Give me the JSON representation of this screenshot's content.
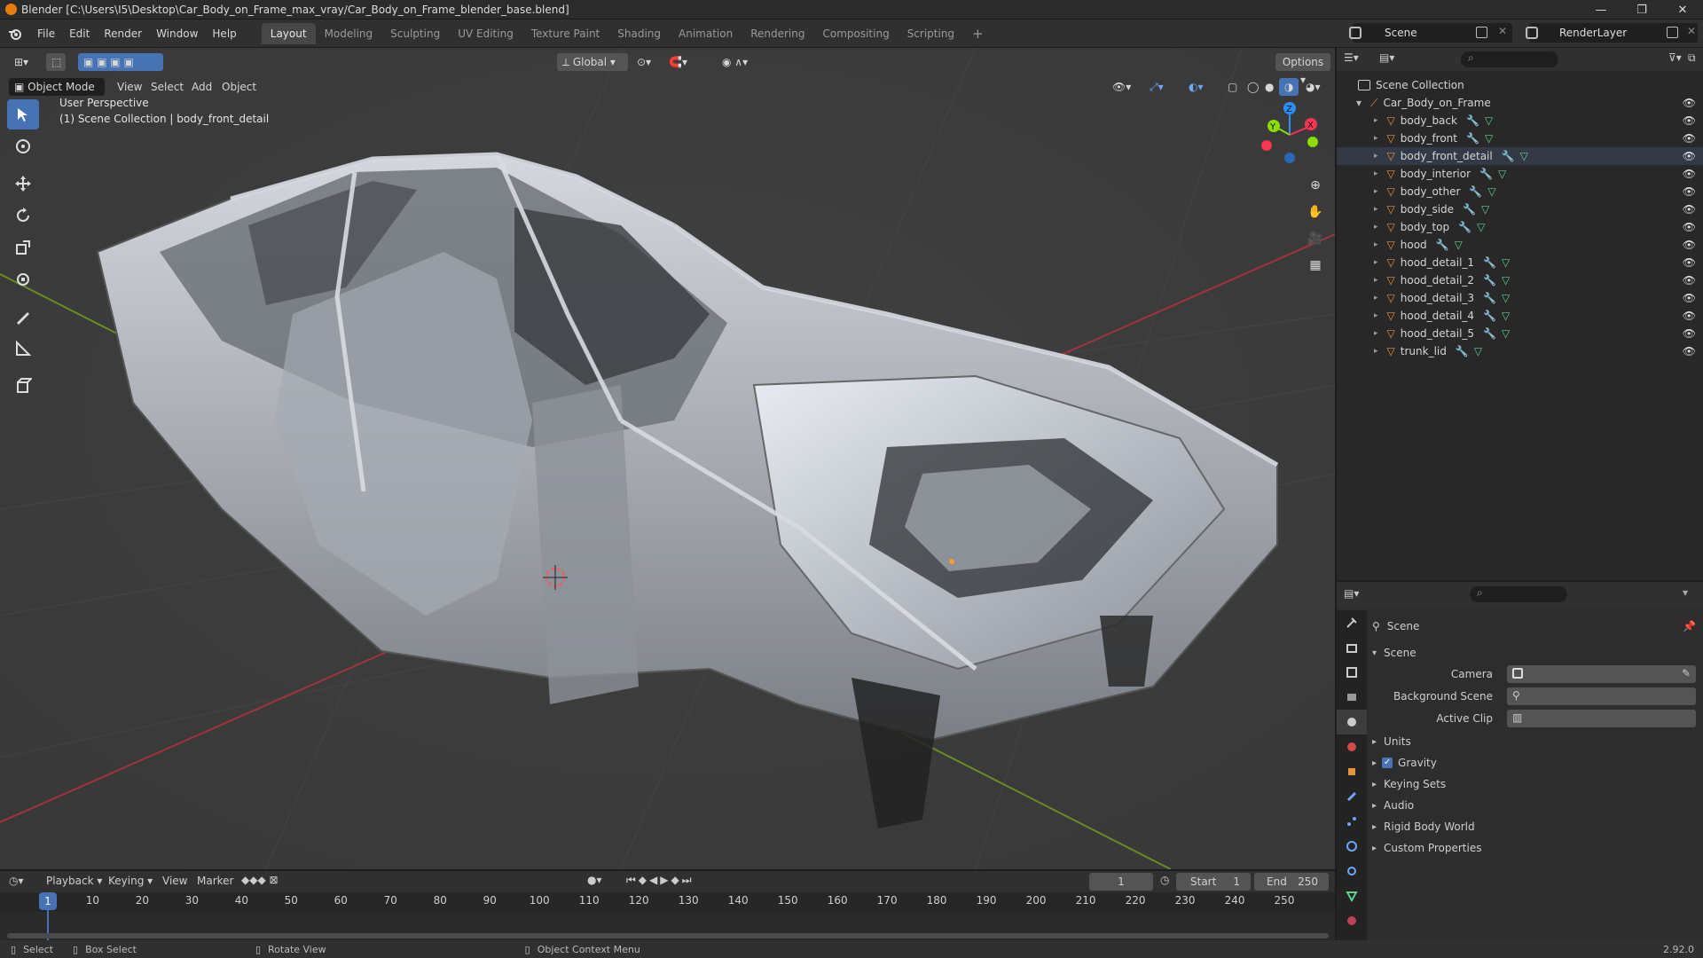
{
  "window": {
    "title": "Blender [C:\\Users\\I5\\Desktop\\Car_Body_on_Frame_max_vray/Car_Body_on_Frame_blender_base.blend]",
    "controls": [
      "—",
      "❐",
      "✕"
    ]
  },
  "menu": {
    "items": [
      "File",
      "Edit",
      "Render",
      "Window",
      "Help"
    ],
    "workspaces": [
      "Layout",
      "Modeling",
      "Sculpting",
      "UV Editing",
      "Texture Paint",
      "Shading",
      "Animation",
      "Rendering",
      "Compositing",
      "Scripting"
    ],
    "active_workspace": "Layout",
    "add_tab": "+",
    "scene": "Scene",
    "render_layer": "RenderLayer"
  },
  "viewport": {
    "mode": "Object Mode",
    "menus": [
      "View",
      "Select",
      "Add",
      "Object"
    ],
    "transform_orientation": "Global",
    "options_label": "Options",
    "perspective_label": "User Perspective",
    "collection_label": "(1) Scene Collection | body_front_detail",
    "gizmo_axes": [
      "Z",
      "X",
      "Y"
    ]
  },
  "outliner": {
    "root": "Scene Collection",
    "collection": "Car_Body_on_Frame",
    "objects": [
      "body_back",
      "body_front",
      "body_front_detail",
      "body_interior",
      "body_other",
      "body_side",
      "body_top",
      "hood",
      "hood_detail_1",
      "hood_detail_2",
      "hood_detail_3",
      "hood_detail_4",
      "hood_detail_5",
      "trunk_lid"
    ],
    "selected": "body_front_detail"
  },
  "properties": {
    "context_title": "Scene",
    "panel_title": "Scene",
    "fields": [
      {
        "label": "Camera",
        "value": ""
      },
      {
        "label": "Background Scene",
        "value": ""
      },
      {
        "label": "Active Clip",
        "value": ""
      }
    ],
    "sections": [
      "Units",
      "Gravity",
      "Keying Sets",
      "Audio",
      "Rigid Body World",
      "Custom Properties"
    ],
    "gravity_enabled": true
  },
  "timeline": {
    "menus": [
      "Playback",
      "Keying",
      "View",
      "Marker"
    ],
    "current_frame": "1",
    "start_label": "Start",
    "start": "1",
    "end_label": "End",
    "end": "250",
    "ticks": [
      "1",
      "10",
      "20",
      "30",
      "40",
      "50",
      "60",
      "70",
      "80",
      "90",
      "100",
      "110",
      "120",
      "130",
      "140",
      "150",
      "160",
      "170",
      "180",
      "190",
      "200",
      "210",
      "220",
      "230",
      "240",
      "250"
    ]
  },
  "statusbar": {
    "items": [
      "Select",
      "Box Select",
      "Rotate View",
      "Object Context Menu"
    ],
    "version": "2.92.0"
  },
  "colors": {
    "accent": "#4772b3",
    "axis_x": "#ff3352",
    "axis_y": "#8bdc00",
    "axis_z": "#2890ff",
    "object_icon": "#e8943a",
    "mesh_icon": "#5dd18e"
  }
}
